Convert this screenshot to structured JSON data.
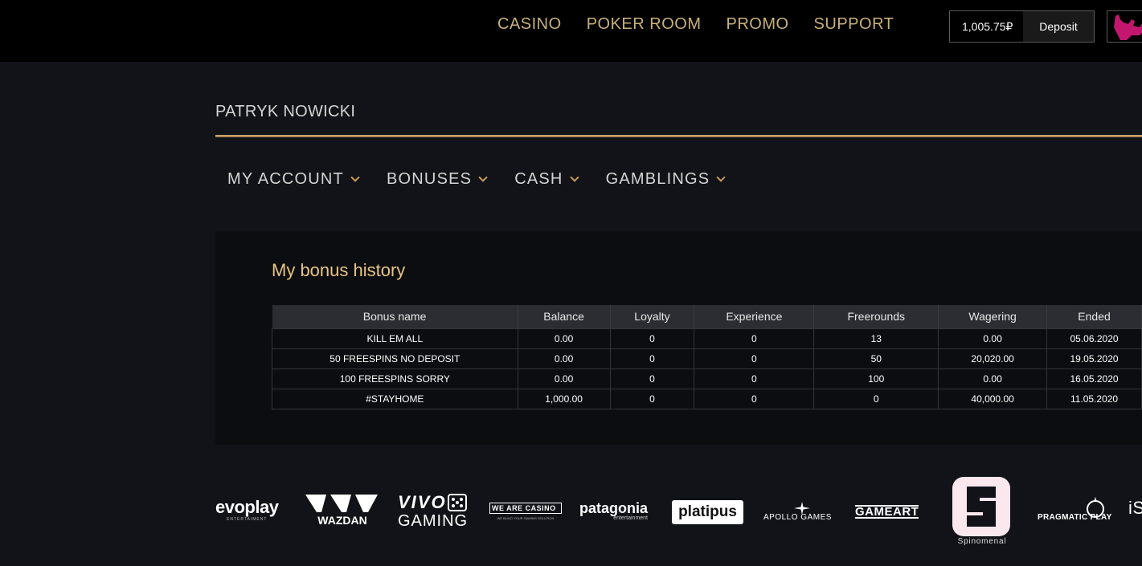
{
  "topnav": {
    "items": [
      "CASINO",
      "POKER ROOM",
      "PROMO",
      "SUPPORT"
    ]
  },
  "wallet": {
    "balance": "1,005.75₽",
    "deposit_label": "Deposit"
  },
  "profile": {
    "name": "PATRYK NOWICKI"
  },
  "subnav": {
    "items": [
      "MY ACCOUNT",
      "BONUSES",
      "CASH",
      "GAMBLINGS"
    ]
  },
  "bonus_history": {
    "title": "My bonus history",
    "columns": [
      "Bonus name",
      "Balance",
      "Loyalty",
      "Experience",
      "Freerounds",
      "Wagering",
      "Ended"
    ],
    "rows": [
      [
        "KILL EM ALL",
        "0.00",
        "0",
        "0",
        "13",
        "0.00",
        "05.06.2020"
      ],
      [
        "50 FREESPINS NO DEPOSIT",
        "0.00",
        "0",
        "0",
        "50",
        "20,020.00",
        "19.05.2020"
      ],
      [
        "100 FREESPINS SORRY",
        "0.00",
        "0",
        "0",
        "100",
        "0.00",
        "16.05.2020"
      ],
      [
        "#STAYHOME",
        "1,000.00",
        "0",
        "0",
        "0",
        "40,000.00",
        "11.05.2020"
      ]
    ]
  },
  "providers": {
    "evoplay": "evoplay",
    "evoplay_sub": "ENTERTAIMENT",
    "wazdan": "WAZDAN",
    "vivo_top": "VIVO",
    "vivo_bottom": "GAMING",
    "wearecasino": "WE ARE CASINO",
    "wearecasino_sub": "WE BUILD YOUR GAMING SOLUTION",
    "patagonia": "patagonia",
    "patagonia_sub": "entertainment",
    "platipus": "platipus",
    "apollo": "APOLLO GAMES",
    "gameart": "GAMEART",
    "spinomenal": "Spinomenal",
    "pragmatic": "PRAGMATIC PLAY",
    "isoft": "iS"
  },
  "colors": {
    "accent_gold": "#c9b17a",
    "title_gold": "#e8c587",
    "avatar_pink": "#c3176f"
  }
}
